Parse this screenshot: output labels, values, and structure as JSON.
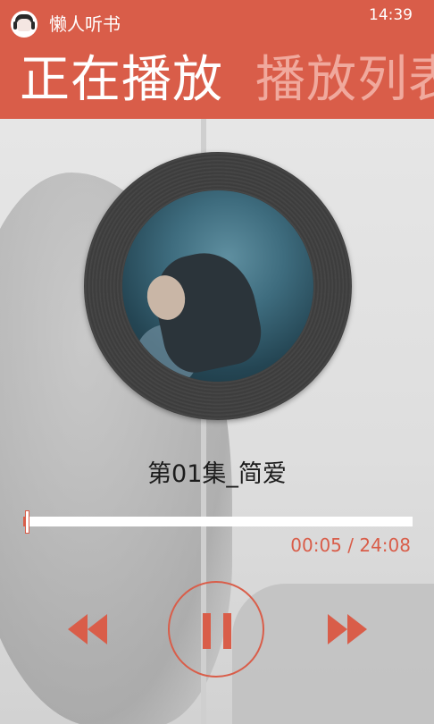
{
  "app": {
    "title": "懒人听书"
  },
  "status": {
    "time": "14:39"
  },
  "pivot": {
    "active": "正在播放",
    "next": "播放列表"
  },
  "track": {
    "title": "第01集_简爱"
  },
  "progress": {
    "elapsed": "00:05",
    "separator": " / ",
    "duration": "24:08",
    "fraction": 0.0035,
    "display": "00:05 / 24:08"
  },
  "controls": {
    "prev_icon": "rewind-icon",
    "pause_icon": "pause-icon",
    "next_icon": "fast-forward-icon"
  },
  "colors": {
    "accent": "#d95d49",
    "header_bg": "#d95d49"
  }
}
